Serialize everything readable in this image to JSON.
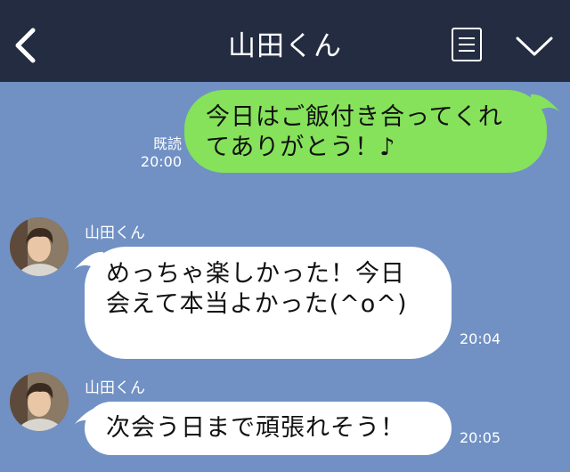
{
  "header": {
    "title": "山田くん",
    "back_icon": "chevron-left-icon",
    "menu_icon": "menu-icon",
    "collapse_icon": "chevron-down-icon"
  },
  "messages": [
    {
      "side": "me",
      "text": "今日はご飯付き合ってくれてありがとう！♪",
      "read_label": "既読",
      "time": "20:00",
      "bubble_color": "#85e25a"
    },
    {
      "side": "friend",
      "sender": "山田くん",
      "text": "めっちゃ楽しかった！今日会えて本当よかった(^o^)",
      "time": "20:04",
      "bubble_color": "#ffffff"
    },
    {
      "side": "friend",
      "sender": "山田くん",
      "text": "次会う日まで頑張れそう！",
      "time": "20:05",
      "bubble_color": "#ffffff"
    }
  ],
  "colors": {
    "background": "#7191c4",
    "header": "#232c41"
  }
}
